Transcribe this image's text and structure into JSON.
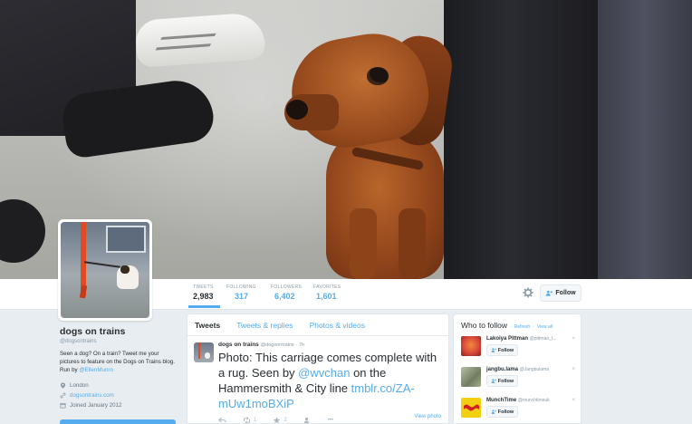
{
  "stats": [
    {
      "label": "TWEETS",
      "value": "2,983"
    },
    {
      "label": "FOLLOWING",
      "value": "317"
    },
    {
      "label": "FOLLOWERS",
      "value": "6,402"
    },
    {
      "label": "FAVORITES",
      "value": "1,601"
    }
  ],
  "follow_button_label": "Follow",
  "profile": {
    "name": "dogs on trains",
    "handle": "@dogsontrains",
    "bio_text": "Seen a dog? On a train? Tweet me your pictures to feature on the Dogs on Trains blog. Run by ",
    "bio_mention": "@EllenMunro",
    "location": "London",
    "website": "dogsontrains.com",
    "joined": "Joined January 2012"
  },
  "timeline": {
    "tabs": [
      "Tweets",
      "Tweets & replies",
      "Photos & videos"
    ],
    "tweet": {
      "author": "dogs on trains",
      "handle": "@dogsontrains",
      "time": "7h",
      "text_1": "Photo: This carriage comes complete with a rug. Seen by ",
      "mention": "@wvchan",
      "text_2": " on the Hammersmith & City line ",
      "link": "tmblr.co/ZA-mUw1moBXiP",
      "retweets": "1",
      "favorites": "2",
      "more": "•••",
      "view_photo": "View photo"
    }
  },
  "who_to_follow": {
    "title": "Who to follow",
    "refresh": "Refresh",
    "view_all": "View all",
    "suggestions": [
      {
        "name": "Lakoiya Pittman",
        "handle": "@pittman_l...",
        "follow": "Follow",
        "color": "#d9473a"
      },
      {
        "name": "jangbu.lama",
        "handle": "@Jangbulama",
        "follow": "Follow",
        "color": "#8e9a7d"
      },
      {
        "name": "MunchTime",
        "handle": "@munchtimeuk",
        "follow": "Follow",
        "color": "#f3cf12"
      }
    ]
  },
  "colors": {
    "accent": "#55acee",
    "text": "#292f33",
    "muted": "#8899a6"
  }
}
